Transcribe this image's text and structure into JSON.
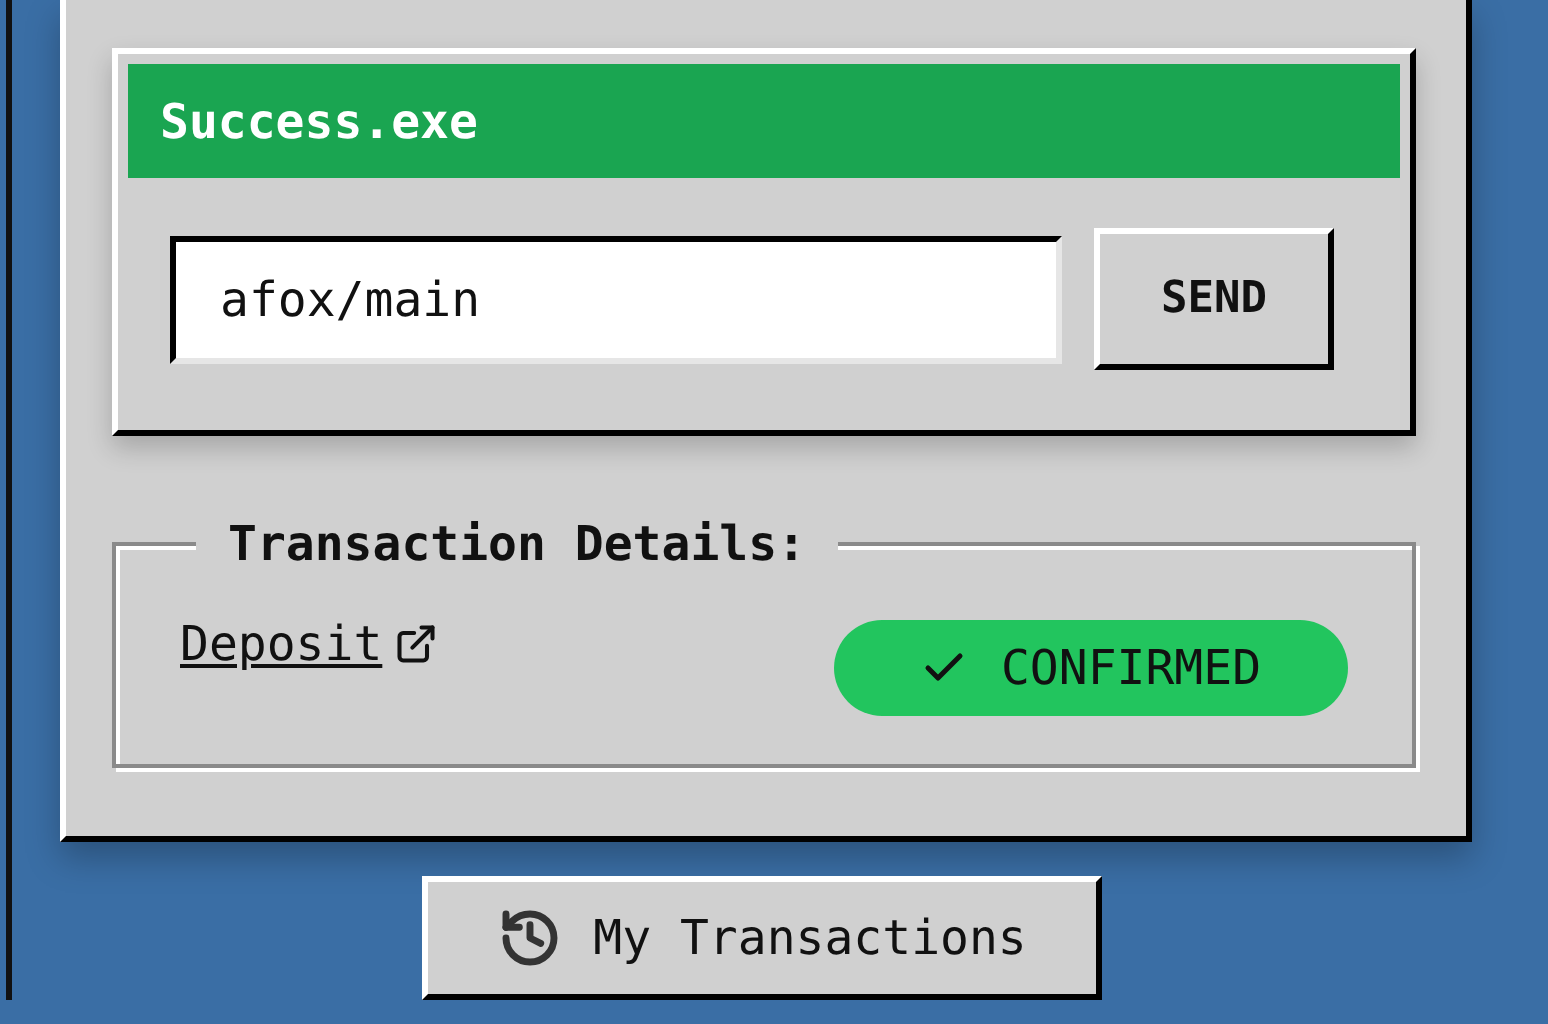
{
  "dialog": {
    "title": "Success.exe",
    "input": {
      "value": "afox/main"
    },
    "button": "SEND"
  },
  "details": {
    "legend": "Transaction Details:",
    "link": "Deposit",
    "status": {
      "label": "CONFIRMED",
      "kind": "confirmed"
    }
  },
  "history_button": "My Transactions"
}
